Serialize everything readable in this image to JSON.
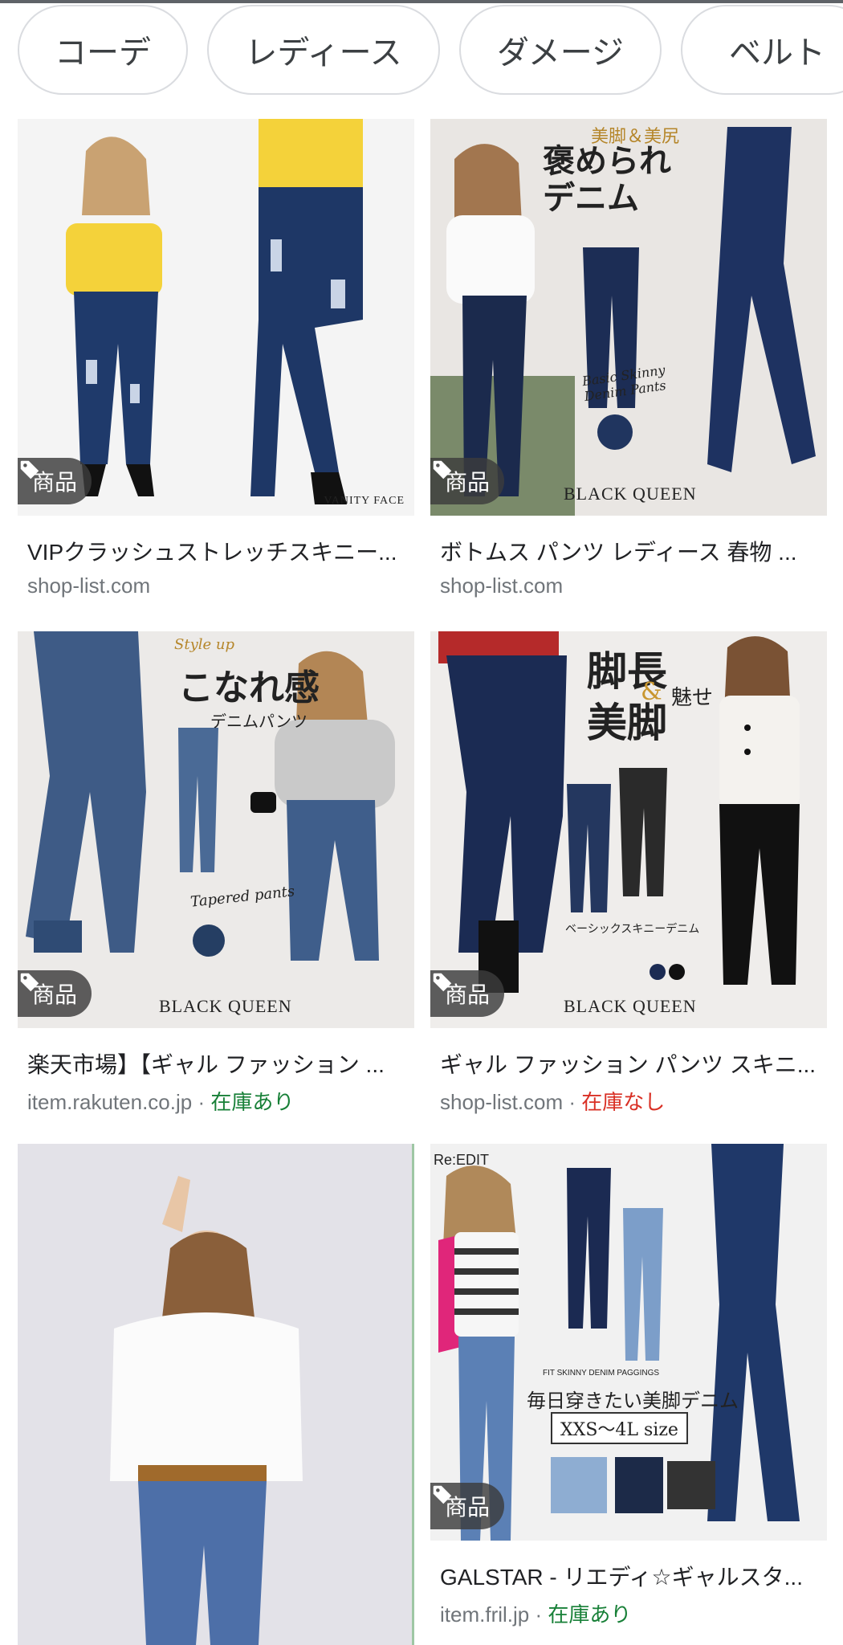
{
  "chips": [
    {
      "label": "コーデ"
    },
    {
      "label": "レディース"
    },
    {
      "label": "ダメージ"
    },
    {
      "label": "ベルト"
    }
  ],
  "badge_label": "商品",
  "results": [
    {
      "title": "VIPクラッシュストレッチスキニー...",
      "source": "shop-list.com",
      "stock": "",
      "image_texts": {
        "brand": "VANITY FACE"
      }
    },
    {
      "title": "ボトムス パンツ レディース 春物 ...",
      "source": "shop-list.com",
      "stock": "",
      "image_texts": {
        "headline": "褒められ\nデニム",
        "sub": "美脚＆美尻",
        "script": "Basic Skinny\nDenim Pants",
        "brand": "BLACK QUEEN"
      }
    },
    {
      "title": "楽天市場】【ギャル ファッション ...",
      "source": "item.rakuten.co.jp",
      "stock": "在庫あり",
      "image_texts": {
        "headline": "こなれ感",
        "sub": "デニムパンツ",
        "script": "Tapered pants",
        "style": "Style up",
        "brand": "BLACK QUEEN"
      }
    },
    {
      "title": "ギャル ファッション パンツ スキニ...",
      "source": "shop-list.com",
      "stock": "在庫なし",
      "image_texts": {
        "headline": "脚長\n美脚",
        "amp": "&",
        "sub": "魅せ",
        "caption": "ベーシックスキニーデニム",
        "brand": "BLACK QUEEN"
      }
    },
    {
      "title": "",
      "source": "",
      "stock": "",
      "image_texts": {}
    },
    {
      "title": "GALSTAR - リエディ☆ギャルスタ...",
      "source": "item.fril.jp",
      "stock": "在庫あり",
      "image_texts": {
        "brand": "Re:EDIT",
        "caption": "FIT SKINNY DENIM PAGGINGS",
        "headline": "毎日穿きたい美脚デニム",
        "size": "XXS〜4L size"
      }
    }
  ],
  "colors": {
    "in_stock": "#188038",
    "out_of_stock": "#d93025",
    "chip_border": "#dadce0"
  }
}
